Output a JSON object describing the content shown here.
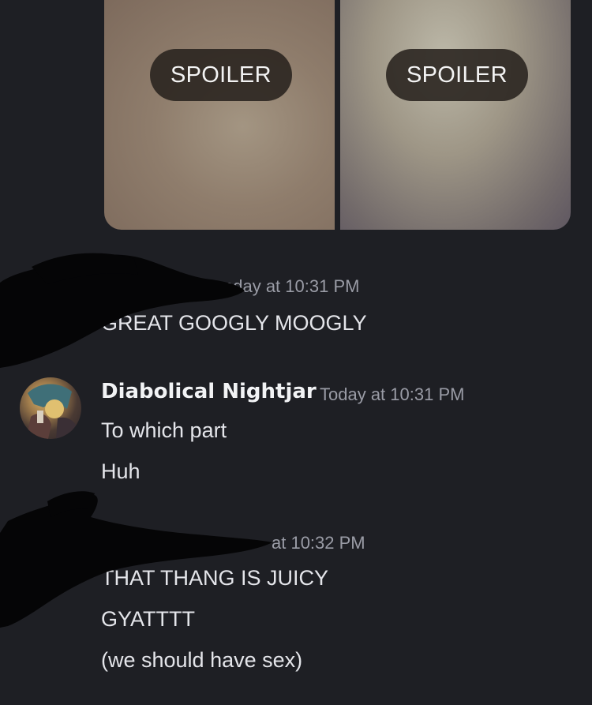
{
  "spoilers": [
    {
      "label": "SPOILER"
    },
    {
      "label": "SPOILER"
    }
  ],
  "messages": [
    {
      "timestamp": "oday at 10:31 PM",
      "lines": [
        "GREAT GOOGLY MOOGLY"
      ]
    },
    {
      "username": "Diabolical Nightjar",
      "timestamp": "Today at 10:31 PM",
      "lines": [
        "To which part",
        "Huh"
      ]
    },
    {
      "timestamp": "at 10:32 PM",
      "lines": [
        "THAT THANG IS JUICY",
        "GYATTTT",
        "(we should have sex)"
      ]
    }
  ],
  "colors": {
    "background": "#1e1f24",
    "text": "#e4e5ea",
    "timestamp": "#9a9ca6",
    "username": "#f2f3f5"
  }
}
